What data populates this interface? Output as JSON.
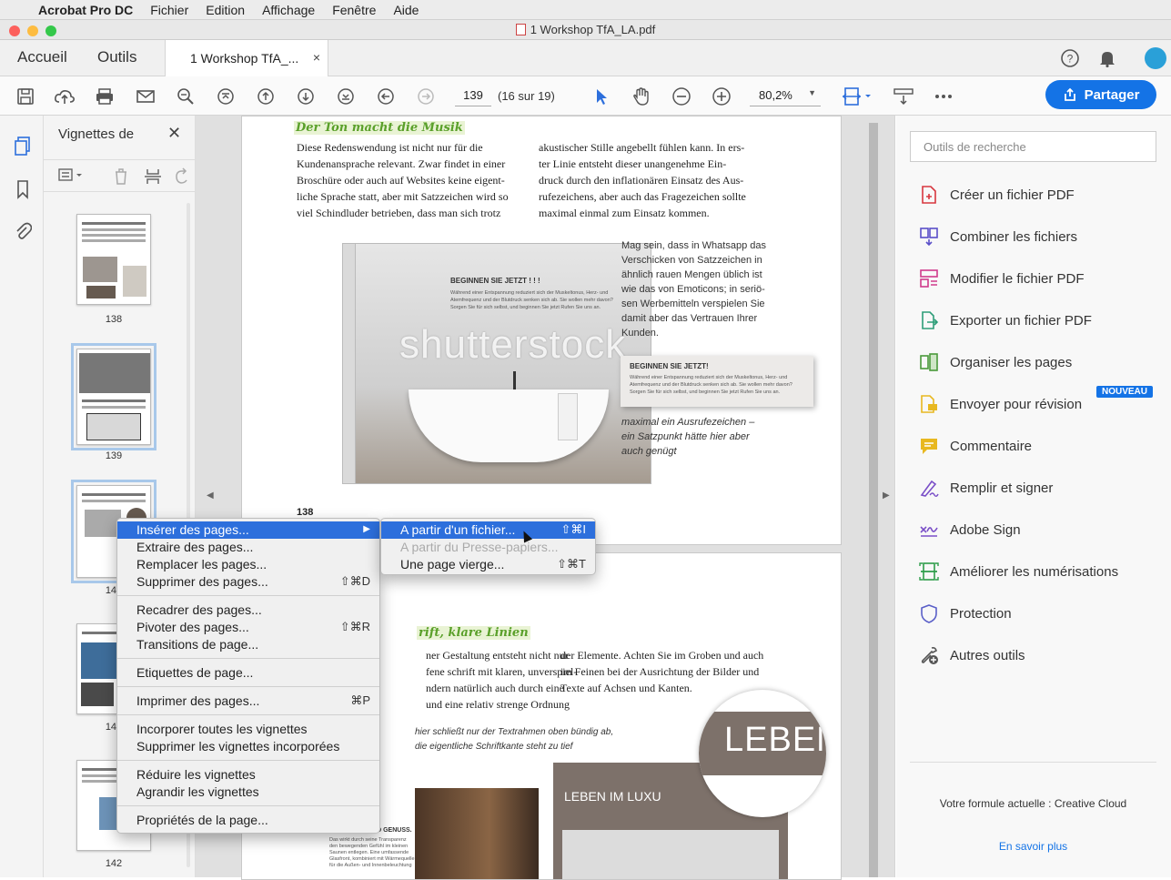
{
  "menubar": {
    "app": "Acrobat Pro DC",
    "items": [
      "Fichier",
      "Edition",
      "Affichage",
      "Fenêtre",
      "Aide"
    ]
  },
  "window": {
    "title": "1  Workshop TfA_LA.pdf"
  },
  "tabs": {
    "home": "Accueil",
    "tools": "Outils",
    "doc": "1  Workshop TfA_...",
    "close": "×"
  },
  "toolbar": {
    "page": "139",
    "page_of": "(16 sur 19)",
    "zoom": "80,2%",
    "share": "Partager"
  },
  "thumbs": {
    "title": "Vignettes de",
    "close": "✕",
    "labels": [
      "138",
      "139",
      "140",
      "141",
      "142"
    ]
  },
  "doc": {
    "heading1": "Der Ton macht die Musik",
    "col1": "Diese Redenswendung ist nicht nur für die\nKundenansprache relevant. Zwar findet in einer\nBroschüre oder auch auf Websites keine eigent-\nliche Sprache statt, aber mit Satzzeichen wird so\nviel Schindluder betrieben, dass man sich trotz",
    "col2": "akustischer Stille angebellt fühlen kann. In ers-\nter Linie entsteht dieser unangenehme Ein-\ndruck durch den inflationären Einsatz des Aus-\nrufezeichens, aber auch das Fragezeichen sollte\nmaximal einmal zum Einsatz kommen.",
    "side": "Mag sein, dass in Whatsapp das\nVerschicken von Satzzeichen in\nähnlich rauen Mengen üblich ist\nwie das von Emoticons; in seriö-\nsen Werbemitteln verspielen Sie\ndamit aber das Vertrauen Ihrer\nKunden.",
    "caption": "maximal ein Ausrufezeichen –\nein Satzpunkt hätte hier aber\nauch genügt",
    "photo_head": "BEGINNEN SIE JETZT ! ! !",
    "photo_body": "Während einer Entspannung reduziert sich der Muskeltonus, Herz- und\nAtemfrequenz und der Blutdruck senken sich ab. Sie wollen mehr davon?\nSorgen Sie für sich selbst, und beginnen Sie jetzt Rufen Sie uns an.",
    "watermark": "shutterstock",
    "callout_head": "BEGINNEN SIE JETZT!",
    "callout_body": "Während einer Entspannung reduziert sich der Muskeltonus, Herz- und\nAtemfrequenz und der Blutdruck senken sich ab. Sie wollen mehr davon?\nSorgen Sie für sich selbst, und beginnen Sie jetzt Rufen Sie uns an.",
    "pagenum": "138",
    "heading2": "rift, klare Linien",
    "col3": "ner Gestaltung entsteht nicht nur\nfene schrift mit klaren, unverspiel-\nndern natürlich auch durch eine\nund eine relativ strenge Ordnung",
    "col4": "der Elemente. Achten Sie im Groben und auch\nim Feinen bei der Ausrichtung der Bilder und\nTexte auf Achsen und Kanten.",
    "note": "hier schließt nur der Textrahmen oben bündig ab,\ndie eigentliche Schriftkante steht zu tief",
    "leben_big": "LEBEN",
    "leben_small": "LEBEN IM LUXU",
    "erholung": "ERHOLUNG UND GENUSS.",
    "erholung_body": "Das wirkt durch seine Transparenz\nden bewegenden Gefühl im kleinen\nSaunen entlegen. Eine umfassende\nGlasfront, kombiniert mit Wärmequelle\nfür die Außen- und Innenbeleuchtung"
  },
  "context_menu": {
    "items": [
      {
        "label": "Insérer des pages...",
        "shortcut": "▶"
      },
      {
        "label": "Extraire des pages...",
        "shortcut": ""
      },
      {
        "label": "Remplacer les pages...",
        "shortcut": ""
      },
      {
        "label": "Supprimer des pages...",
        "shortcut": "⇧⌘D"
      },
      {
        "label": "Recadrer des pages...",
        "shortcut": ""
      },
      {
        "label": "Pivoter des pages...",
        "shortcut": "⇧⌘R"
      },
      {
        "label": "Transitions de page...",
        "shortcut": ""
      },
      {
        "label": "Etiquettes de page...",
        "shortcut": ""
      },
      {
        "label": "Imprimer des pages...",
        "shortcut": "⌘P"
      },
      {
        "label": "Incorporer toutes les vignettes",
        "shortcut": ""
      },
      {
        "label": "Supprimer les vignettes incorporées",
        "shortcut": ""
      },
      {
        "label": "Réduire les vignettes",
        "shortcut": ""
      },
      {
        "label": "Agrandir les vignettes",
        "shortcut": ""
      },
      {
        "label": "Propriétés de la page...",
        "shortcut": ""
      }
    ]
  },
  "submenu": {
    "items": [
      {
        "label": "A partir d'un fichier...",
        "shortcut": "⇧⌘I"
      },
      {
        "label": "A partir du Presse-papiers...",
        "shortcut": ""
      },
      {
        "label": "Une page vierge...",
        "shortcut": "⇧⌘T"
      }
    ]
  },
  "right_panel": {
    "search_placeholder": "Outils de recherche",
    "tools": [
      {
        "label": "Créer un fichier PDF",
        "color": "#d7373f",
        "icon": "create-pdf-icon"
      },
      {
        "label": "Combiner les fichiers",
        "color": "#5a4fc8",
        "icon": "combine-icon"
      },
      {
        "label": "Modifier le fichier PDF",
        "color": "#d03a8c",
        "icon": "edit-pdf-icon"
      },
      {
        "label": "Exporter un fichier PDF",
        "color": "#2d9d78",
        "icon": "export-pdf-icon"
      },
      {
        "label": "Organiser les pages",
        "color": "#4a9a3a",
        "icon": "organize-icon"
      },
      {
        "label": "Envoyer pour révision",
        "color": "#e8b820",
        "icon": "review-icon"
      },
      {
        "label": "Commentaire",
        "color": "#e8b820",
        "icon": "comment-icon"
      },
      {
        "label": "Remplir et signer",
        "color": "#7a4fc8",
        "icon": "fill-sign-icon"
      },
      {
        "label": "Adobe Sign",
        "color": "#7a4fc8",
        "icon": "adobe-sign-icon"
      },
      {
        "label": "Améliorer les numérisations",
        "color": "#2d9d4a",
        "icon": "scan-icon"
      },
      {
        "label": "Protection",
        "color": "#5a5fc8",
        "icon": "shield-icon"
      },
      {
        "label": "Autres outils",
        "color": "#555555",
        "icon": "more-tools-icon"
      }
    ],
    "badge": "NOUVEAU",
    "plan": "Votre formule actuelle : Creative Cloud",
    "learn_more": "En savoir plus"
  }
}
